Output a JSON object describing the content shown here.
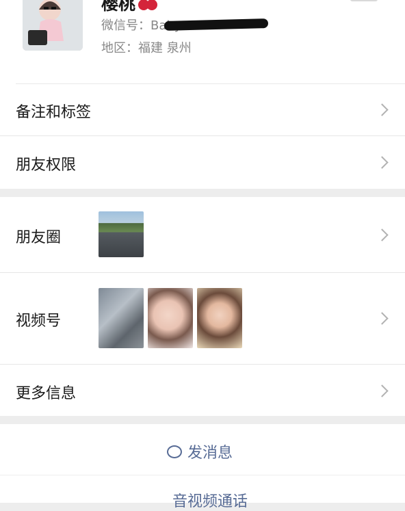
{
  "profile": {
    "nickname": "樱桃",
    "wechat_id_prefix": "微信号：Baby",
    "region": "地区：福建 泉州"
  },
  "group1": {
    "items": [
      {
        "label": "备注和标签"
      },
      {
        "label": "朋友权限"
      }
    ]
  },
  "group2": {
    "moments_label": "朋友圈",
    "channels_label": "视频号",
    "more_label": "更多信息"
  },
  "actions": {
    "send_message": "发消息",
    "call": "音视频通话"
  },
  "colors": {
    "link": "#576b95",
    "background": "#ededed"
  }
}
